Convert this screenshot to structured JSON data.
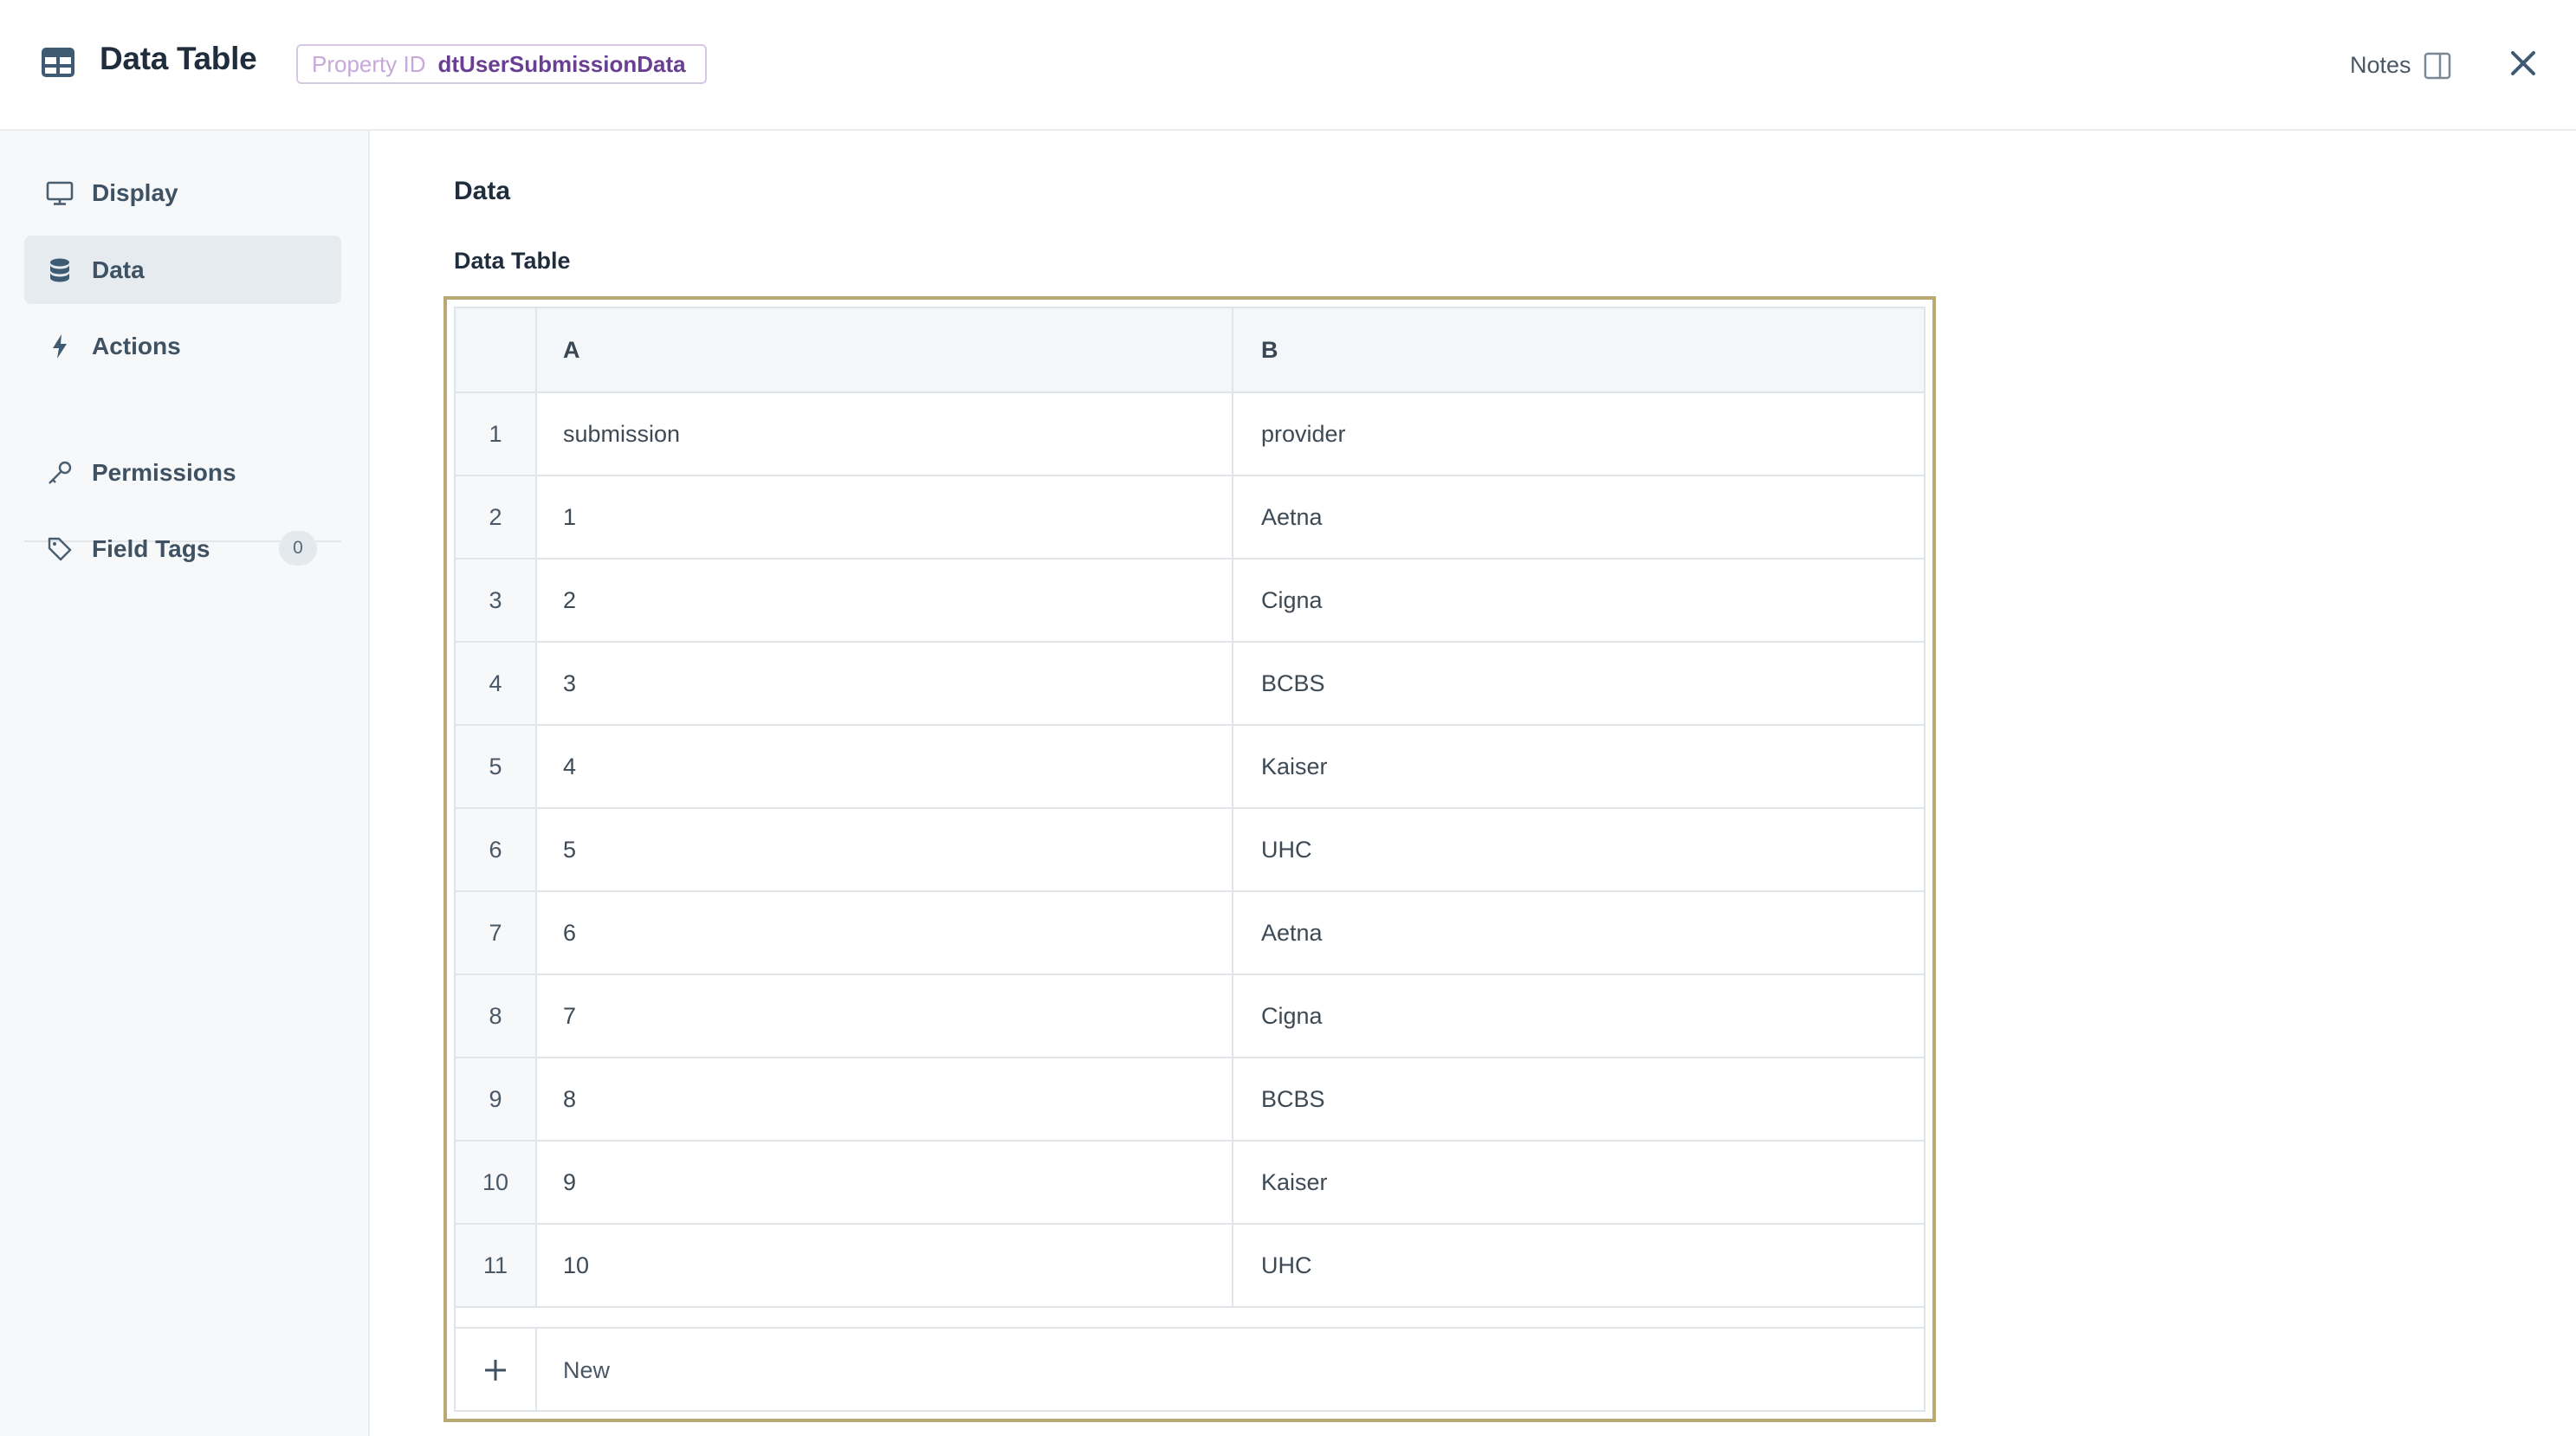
{
  "header": {
    "title": "Data Table",
    "property_id_label": "Property ID",
    "property_id_value": "dtUserSubmissionData",
    "notes_label": "Notes"
  },
  "sidebar": {
    "items": [
      {
        "label": "Display",
        "icon": "monitor-icon",
        "active": false
      },
      {
        "label": "Data",
        "icon": "database-icon",
        "active": true
      },
      {
        "label": "Actions",
        "icon": "lightning-icon",
        "active": false
      },
      {
        "label": "Permissions",
        "icon": "key-icon",
        "active": false
      },
      {
        "label": "Field Tags",
        "icon": "tag-icon",
        "active": false,
        "count": "0"
      }
    ]
  },
  "main": {
    "section_title": "Data",
    "table_title": "Data Table",
    "columns": [
      "A",
      "B"
    ],
    "rows": [
      {
        "index": "1",
        "a": "submission",
        "b": "provider"
      },
      {
        "index": "2",
        "a": "1",
        "b": "Aetna"
      },
      {
        "index": "3",
        "a": "2",
        "b": "Cigna"
      },
      {
        "index": "4",
        "a": "3",
        "b": "BCBS"
      },
      {
        "index": "5",
        "a": "4",
        "b": "Kaiser"
      },
      {
        "index": "6",
        "a": "5",
        "b": "UHC"
      },
      {
        "index": "7",
        "a": "6",
        "b": "Aetna"
      },
      {
        "index": "8",
        "a": "7",
        "b": "Cigna"
      },
      {
        "index": "9",
        "a": "8",
        "b": "BCBS"
      },
      {
        "index": "10",
        "a": "9",
        "b": "Kaiser"
      },
      {
        "index": "11",
        "a": "10",
        "b": "UHC"
      }
    ],
    "new_row_label": "New"
  },
  "colors": {
    "accent_border": "#b8aa72",
    "property_id_text": "#6a3e93"
  }
}
